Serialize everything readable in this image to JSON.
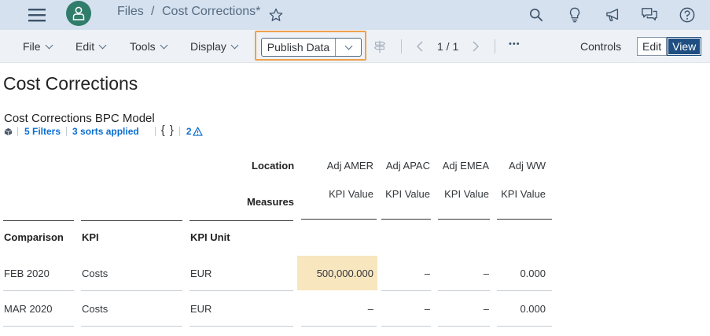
{
  "shell": {
    "breadcrumb_files": "Files",
    "breadcrumb_sep": "/",
    "breadcrumb_doc": "Cost Corrections*"
  },
  "toolbar": {
    "menus": [
      "File",
      "Edit",
      "Tools",
      "Display"
    ],
    "publish_label": "Publish Data",
    "pager": "1 / 1",
    "more": "•••",
    "controls_label": "Controls",
    "edit_label": "Edit",
    "view_label": "View",
    "mode_selected": "View"
  },
  "page": {
    "title": "Cost Corrections",
    "widget_title": "Cost Corrections BPC Model",
    "filters": "5 Filters",
    "sorts": "3 sorts applied",
    "braces": "{ }",
    "warning_count": "2"
  },
  "table": {
    "location_label": "Location",
    "measures_label": "Measures",
    "columns": [
      {
        "location": "Adj AMER",
        "measure": "KPI Value"
      },
      {
        "location": "Adj APAC",
        "measure": "KPI Value"
      },
      {
        "location": "Adj EMEA",
        "measure": "KPI Value"
      },
      {
        "location": "Adj WW",
        "measure": "KPI Value"
      }
    ],
    "row_headers": [
      "Comparison",
      "KPI",
      "KPI Unit"
    ],
    "rows": [
      {
        "comparison": "FEB 2020",
        "kpi": "Costs",
        "unit": "EUR",
        "values": [
          "500,000.000",
          "–",
          "–",
          "0.000"
        ]
      },
      {
        "comparison": "MAR 2020",
        "kpi": "Costs",
        "unit": "EUR",
        "values": [
          "–",
          "–",
          "–",
          "0.000"
        ]
      }
    ],
    "highlight_color": "#f8e6be"
  }
}
